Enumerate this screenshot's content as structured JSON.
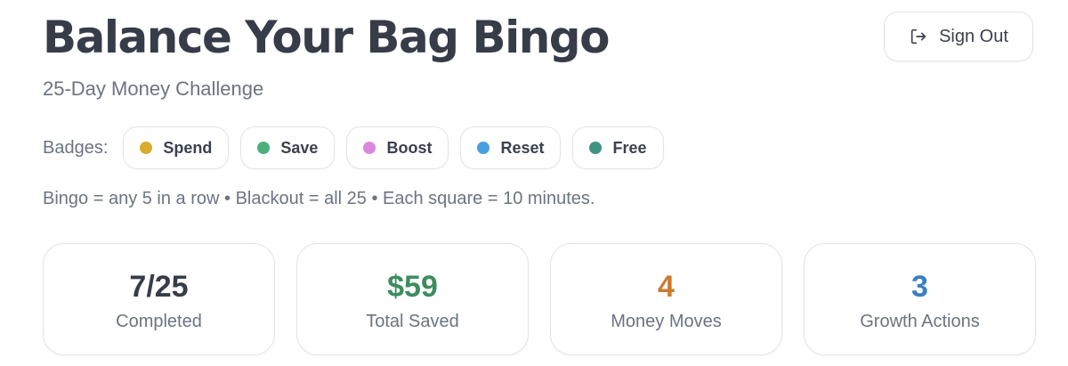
{
  "header": {
    "title": "Balance Your Bag Bingo",
    "subtitle": "25-Day Money Challenge",
    "signout_label": "Sign Out",
    "signout_icon": "sign-out-icon"
  },
  "badges": {
    "label": "Badges:",
    "items": [
      {
        "label": "Spend",
        "color": "#d9ac2b"
      },
      {
        "label": "Save",
        "color": "#4caf7d"
      },
      {
        "label": "Boost",
        "color": "#dd86e0"
      },
      {
        "label": "Reset",
        "color": "#4a9fe0"
      },
      {
        "label": "Free",
        "color": "#3f9382"
      }
    ]
  },
  "rules": "Bingo = any 5 in a row • Blackout = all 25 • Each square = 10 minutes.",
  "stats": [
    {
      "value": "7/25",
      "label": "Completed",
      "color": "#363c48"
    },
    {
      "value": "$59",
      "label": "Total Saved",
      "color": "#3d8d5f"
    },
    {
      "value": "4",
      "label": "Money Moves",
      "color": "#cc7a2c"
    },
    {
      "value": "3",
      "label": "Growth Actions",
      "color": "#3a7fc0"
    }
  ]
}
